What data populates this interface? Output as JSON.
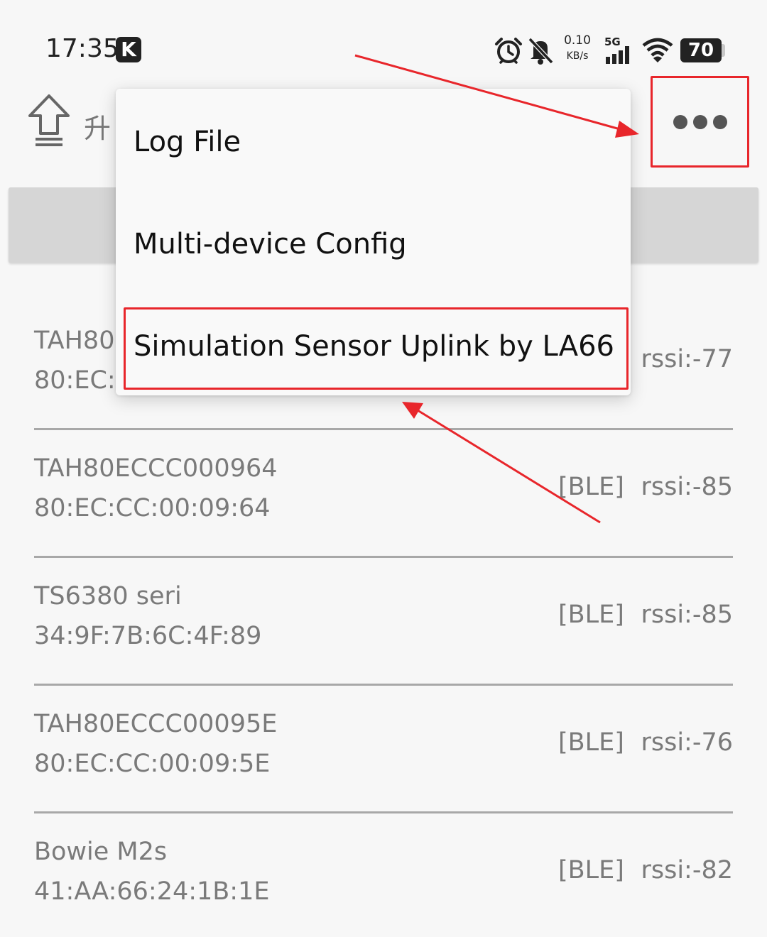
{
  "status_bar": {
    "time": "17:35",
    "badge": "K",
    "net_speed_value": "0.10",
    "net_speed_unit": "KB/s",
    "network": "5G",
    "battery": "70",
    "icons": [
      "alarm-icon",
      "bell-muted-icon",
      "signal-5g-icon",
      "wifi-icon",
      "battery-icon"
    ]
  },
  "app_bar": {
    "title_fragment": "升",
    "upgrade_icon": "upload-arrow-icon",
    "more_icon": "more-dots-icon"
  },
  "menu": {
    "items": [
      {
        "label": "Log File"
      },
      {
        "label": "Multi-device Config"
      },
      {
        "label": "Simulation Sensor Uplink by LA66"
      }
    ]
  },
  "devices": [
    {
      "name": "TAH80",
      "mac": "80:EC:C",
      "type": "",
      "rssi": "rssi:-77"
    },
    {
      "name": "TAH80ECCC000964",
      "mac": "80:EC:CC:00:09:64",
      "type": "[BLE]",
      "rssi": "rssi:-85"
    },
    {
      "name": "TS6380 seri",
      "mac": "34:9F:7B:6C:4F:89",
      "type": "[BLE]",
      "rssi": "rssi:-85"
    },
    {
      "name": "TAH80ECCC00095E",
      "mac": "80:EC:CC:00:09:5E",
      "type": "[BLE]",
      "rssi": "rssi:-76"
    },
    {
      "name": "Bowie M2s",
      "mac": "41:AA:66:24:1B:1E",
      "type": "[BLE]",
      "rssi": "rssi:-82"
    }
  ],
  "colors": {
    "annotation": "#e8262b",
    "text_primary": "#111111",
    "text_secondary": "#7a7a7a",
    "background": "#f7f7f7"
  }
}
